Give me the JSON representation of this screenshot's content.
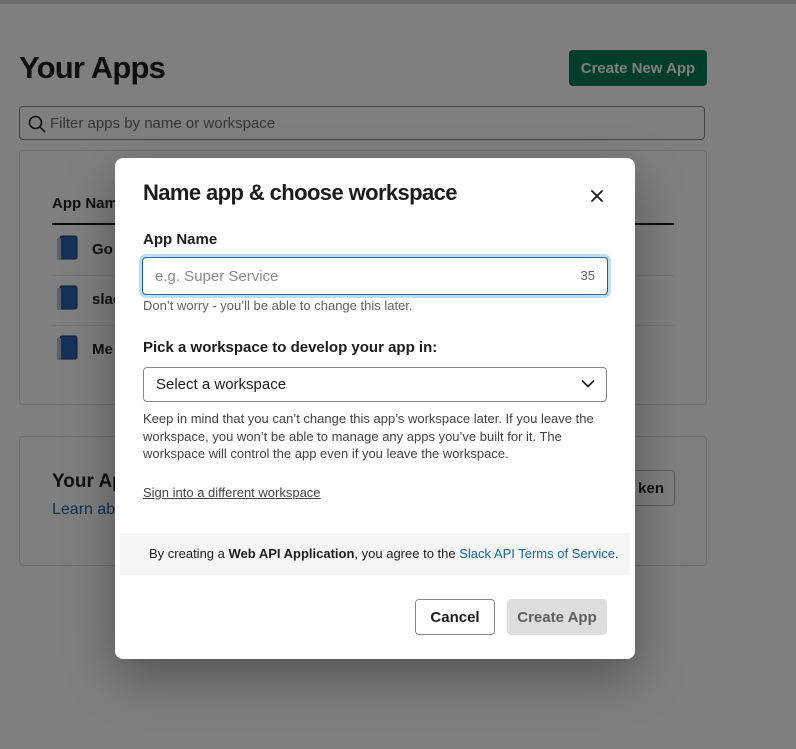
{
  "page": {
    "title": "Your Apps",
    "create_button": "Create New App",
    "filter_placeholder": "Filter apps by name or workspace",
    "apps_table": {
      "column_header": "App Nam",
      "rows": [
        {
          "name": "Go"
        },
        {
          "name": "slac"
        },
        {
          "name": "Me"
        }
      ]
    },
    "tokens": {
      "title": "Your Ap",
      "link": "Learn abo",
      "button": "ken"
    }
  },
  "modal": {
    "title": "Name app & choose workspace",
    "app_name_label": "App Name",
    "app_name_placeholder": "e.g. Super Service",
    "char_count": "35",
    "app_name_hint": "Don’t worry - you’ll be able to change this later.",
    "workspace_label": "Pick a workspace to develop your app in:",
    "workspace_select": "Select a workspace",
    "workspace_note": "Keep in mind that you can’t change this app’s workspace later. If you leave the workspace, you won’t be able to manage any apps you’ve built for it. The workspace will control the app even if you leave the workspace.",
    "sign_in_link": "Sign into a different workspace",
    "terms": {
      "prefix": "By creating a ",
      "bold": "Web API Application",
      "middle": ", you agree to the ",
      "link": "Slack API Terms of Service",
      "suffix": "."
    },
    "cancel_button": "Cancel",
    "create_button": "Create App"
  },
  "colors": {
    "primary_green": "#007a5a",
    "link_blue": "#1264a3",
    "focus_ring": "#1d9bd1",
    "app_icon_blue": "#2a66b5"
  }
}
